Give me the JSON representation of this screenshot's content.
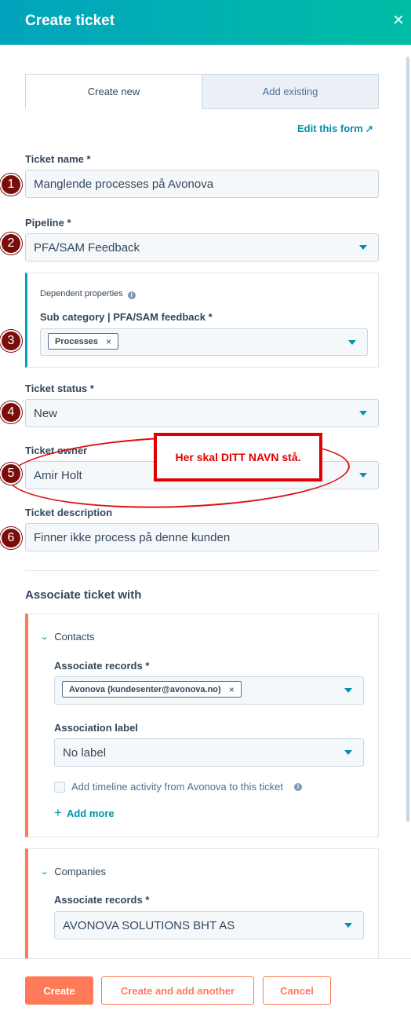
{
  "header": {
    "title": "Create ticket",
    "close_icon": "×"
  },
  "tabs": [
    {
      "label": "Create new"
    },
    {
      "label": "Add existing"
    }
  ],
  "edit_form": {
    "label": "Edit this form",
    "icon": "↗"
  },
  "fields": {
    "ticket_name": {
      "label": "Ticket name *",
      "value": "Manglende processes på Avonova"
    },
    "pipeline": {
      "label": "Pipeline *",
      "value": "PFA/SAM Feedback"
    },
    "dependent": {
      "title": "Dependent properties",
      "info": "i",
      "sub_label": "Sub category | PFA/SAM feedback *",
      "tag": "Processes",
      "tag_remove": "×"
    },
    "ticket_status": {
      "label": "Ticket status *",
      "value": "New"
    },
    "ticket_owner": {
      "label": "Ticket owner",
      "value": "Amir Holt"
    },
    "ticket_description": {
      "label": "Ticket description",
      "value": "Finner ikke process på denne kunden"
    }
  },
  "badges": [
    "1",
    "2",
    "3",
    "4",
    "5",
    "6"
  ],
  "annotation": {
    "text": "Her skal DITT NAVN stå.",
    "color": "#e00000"
  },
  "associate": {
    "title": "Associate ticket with",
    "contacts": {
      "heading": "Contacts",
      "chevron": "⌄",
      "records_label": "Associate records *",
      "record_tag": "Avonova (kundesenter@avonova.no)",
      "record_remove": "×",
      "assoc_label": "Association label",
      "assoc_value": "No label",
      "checkbox_label": "Add timeline activity from Avonova to this ticket",
      "info": "i",
      "add_more": "Add more",
      "plus": "+"
    },
    "companies": {
      "heading": "Companies",
      "chevron": "⌄",
      "records_label": "Associate records *",
      "record_value": "AVONOVA SOLUTIONS BHT AS"
    }
  },
  "footer": {
    "create": "Create",
    "create_another": "Create and add another",
    "cancel": "Cancel"
  },
  "colors": {
    "header_start": "#00a4bd",
    "header_end": "#00bda5",
    "accent_orange": "#ff7a59",
    "link_teal": "#0091ae",
    "badge_red": "#7b0c0c"
  }
}
